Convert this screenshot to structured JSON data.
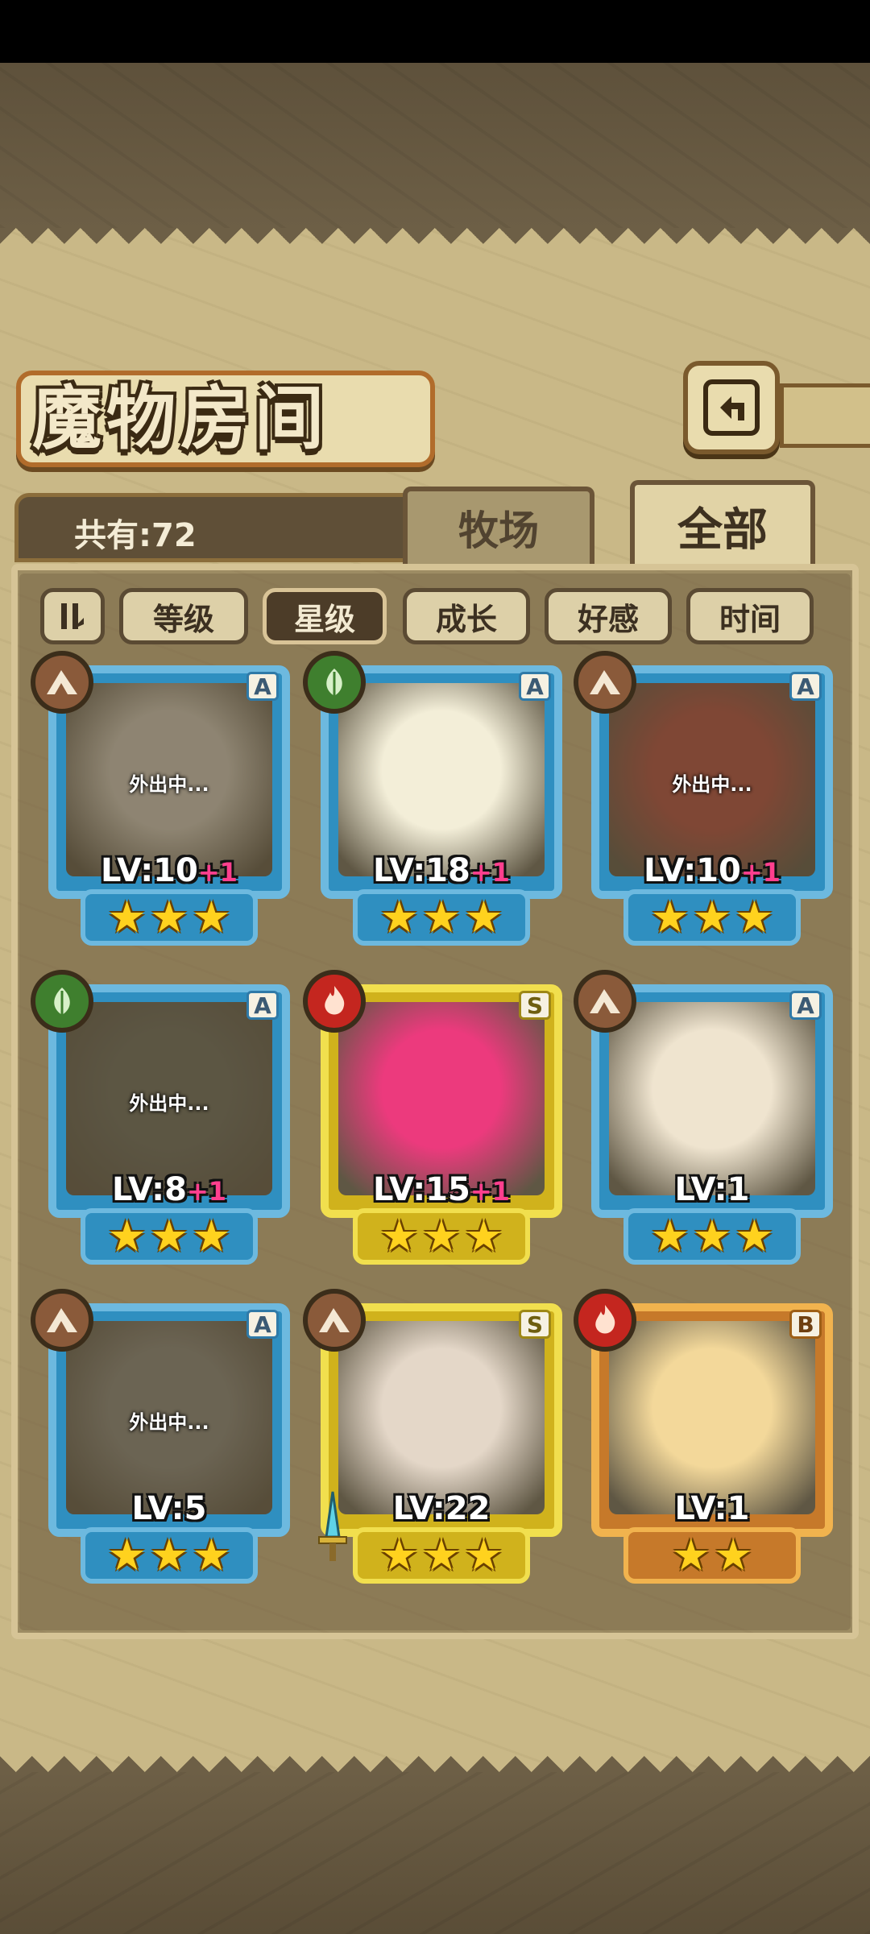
{
  "title": "魔物房间",
  "count_text": "共有:72",
  "tabs": {
    "pasture": "牧场",
    "all": "全部"
  },
  "sort": [
    "等级",
    "星级",
    "成长",
    "好感",
    "时间"
  ],
  "sort_active": "星级",
  "cards": [
    {
      "rank": "A",
      "element": "earth",
      "away": "外出中...",
      "lv": "LV:10",
      "plus": "+1",
      "stars": 3,
      "frame": "blue"
    },
    {
      "rank": "A",
      "element": "leaf",
      "away": "",
      "lv": "LV:18",
      "plus": "+1",
      "stars": 3,
      "frame": "blue"
    },
    {
      "rank": "A",
      "element": "earth",
      "away": "外出中...",
      "lv": "LV:10",
      "plus": "+1",
      "stars": 3,
      "frame": "blue"
    },
    {
      "rank": "A",
      "element": "leaf",
      "away": "外出中...",
      "lv": "LV:8",
      "plus": "+1",
      "stars": 3,
      "frame": "blue"
    },
    {
      "rank": "S",
      "element": "fire",
      "away": "",
      "lv": "LV:15",
      "plus": "+1",
      "stars": 3,
      "frame": "gold"
    },
    {
      "rank": "A",
      "element": "earth",
      "away": "",
      "lv": "LV:1",
      "plus": "",
      "stars": 3,
      "frame": "blue"
    },
    {
      "rank": "A",
      "element": "earth",
      "away": "外出中...",
      "lv": "LV:5",
      "plus": "",
      "stars": 3,
      "frame": "blue"
    },
    {
      "rank": "S",
      "element": "earth",
      "away": "",
      "lv": "LV:22",
      "plus": "",
      "stars": 3,
      "frame": "gold"
    },
    {
      "rank": "B",
      "element": "fire",
      "away": "",
      "lv": "LV:1",
      "plus": "",
      "stars": 2,
      "frame": "orange"
    }
  ],
  "colors": {
    "panel": "#c9b887",
    "frame_blue": "#6db9df",
    "frame_gold": "#f1df4e",
    "frame_orange": "#f1b34e",
    "level_plus": "#ff3f8e",
    "star": "#ffd21e"
  },
  "icons": {
    "back": "return-arrow-icon",
    "order": "sort-order-icon",
    "earth": "mountain-icon",
    "leaf": "leaf-icon",
    "fire": "flame-icon",
    "weapon": "sword-icon"
  }
}
